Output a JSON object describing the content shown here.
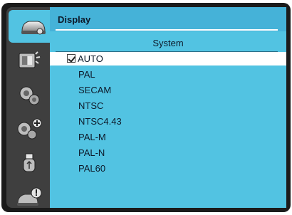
{
  "menu": {
    "tabs": [
      {
        "icon": "display-icon",
        "active": true
      },
      {
        "icon": "picture-adjust-icon",
        "active": false
      },
      {
        "icon": "setting-gear-icon",
        "active": false
      },
      {
        "icon": "expanded-setting-icon",
        "active": false
      },
      {
        "icon": "usb-memory-icon",
        "active": false
      },
      {
        "icon": "info-icon",
        "active": false
      }
    ]
  },
  "panel": {
    "title": "Display",
    "section": "System",
    "items": [
      "AUTO",
      "PAL",
      "SECAM",
      "NTSC",
      "NTSC4.43",
      "PAL-M",
      "PAL-N",
      "PAL60"
    ],
    "selected_index": 0
  },
  "colors": {
    "accent": "#52c3e2",
    "header": "#45b2d8",
    "frame": "#1b1b1b",
    "sidebar": "#3f3f3f"
  }
}
